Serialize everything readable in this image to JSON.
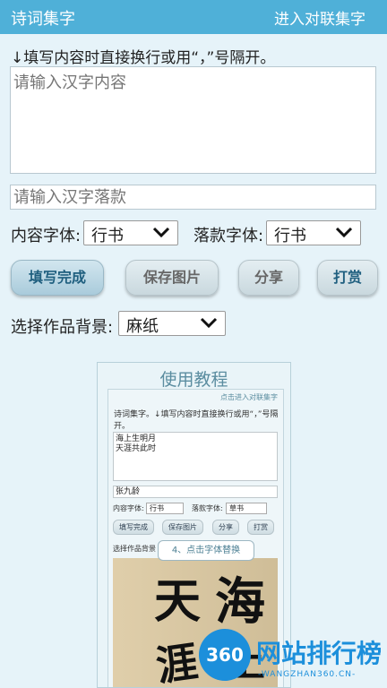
{
  "topbar": {
    "title": "诗词集字",
    "action": "进入对联集字"
  },
  "hint": "↓填写内容时直接换行或用“，”号隔开。",
  "content_input": {
    "placeholder": "请输入汉字内容",
    "value": ""
  },
  "sign_input": {
    "placeholder": "请输入汉字落款",
    "value": ""
  },
  "content_font": {
    "label": "内容字体:",
    "value": "行书"
  },
  "sign_font": {
    "label": "落款字体:",
    "value": "行书"
  },
  "buttons": {
    "fill": "填写完成",
    "save": "保存图片",
    "share": "分享",
    "reward": "打赏"
  },
  "background": {
    "label": "选择作品背景:",
    "value": "麻纸"
  },
  "tutorial": {
    "title": "使用教程",
    "link": "点击进入对联集字",
    "hint": "诗词集字。↓填写内容时直接换行或用“，”号隔开。",
    "content_lines": [
      "海上生明月",
      "天涯共此时"
    ],
    "sign": "张九龄",
    "content_font_label": "内容字体:",
    "content_font_value": "行书",
    "sign_font_label": "落款字体:",
    "sign_font_value": "草书",
    "buttons": {
      "fill": "填写完成",
      "save": "保存图片",
      "share": "分享",
      "reward": "打赏"
    },
    "bg_label": "选择作品背景",
    "callout": "4、点击字体替换",
    "glyphs": [
      "天",
      "海",
      "涯",
      "上"
    ]
  },
  "watermark": {
    "logo": "360",
    "name": "网站排行榜",
    "url": "-WANGZHAN360.CN-"
  },
  "colors": {
    "topbar": "#4fb0d8",
    "background": "#e6f3f9",
    "brand_blue": "#1c8fdb"
  },
  "icons": {
    "select_arrow": "chevron-down-icon"
  }
}
